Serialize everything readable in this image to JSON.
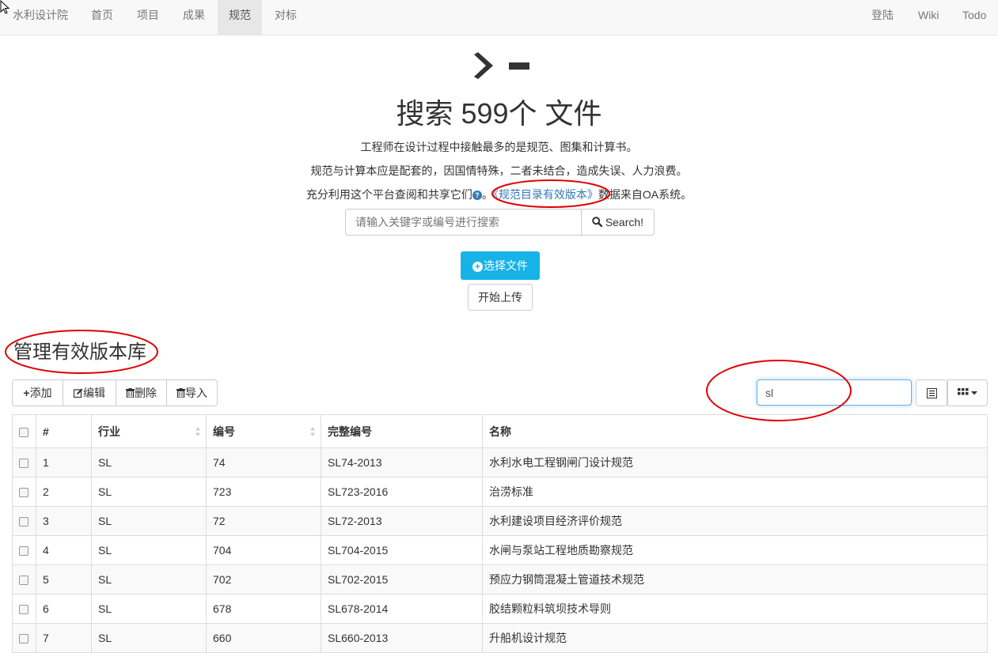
{
  "navbar": {
    "brand": "水利设计院",
    "items": [
      {
        "label": "首页",
        "active": false
      },
      {
        "label": "项目",
        "active": false
      },
      {
        "label": "成果",
        "active": false
      },
      {
        "label": "规范",
        "active": true
      },
      {
        "label": "对标",
        "active": false
      }
    ],
    "right_items": [
      "登陆",
      "Wiki",
      "Todo"
    ]
  },
  "hero": {
    "title": "搜索 599个 文件",
    "line1": "工程师在设计过程中接触最多的是规范、图集和计算书。",
    "line2": "规范与计算本应是配套的，因国情特殊，二者未结合，造成失误、人力浪费。",
    "line3_prefix": "充分利用这个平台查阅和共享它们",
    "line3_sep": "。",
    "line3_link": "《规范目录有效版本》",
    "line3_suffix": "数据来自OA系统。",
    "help_icon": "question-circle-icon"
  },
  "search": {
    "placeholder": "请输入关键字或编号进行搜索",
    "button_label": "Search!",
    "button_icon": "search-icon"
  },
  "upload": {
    "select_label": "选择文件",
    "select_icon": "plus-circle-icon",
    "start_label": "开始上传"
  },
  "section": {
    "title": "管理有效版本库"
  },
  "toolbar": {
    "buttons": [
      {
        "label": "添加",
        "icon": "plus-icon"
      },
      {
        "label": "编辑",
        "icon": "edit-icon"
      },
      {
        "label": "删除",
        "icon": "trash-icon"
      },
      {
        "label": "导入",
        "icon": "trash-icon"
      }
    ],
    "filter_value": "sl"
  },
  "table": {
    "columns": [
      "#",
      "行业",
      "编号",
      "完整编号",
      "名称"
    ],
    "rows": [
      {
        "num": "1",
        "industry": "SL",
        "code": "74",
        "full_code": "SL74-2013",
        "name": "水利水电工程钢闸门设计规范"
      },
      {
        "num": "2",
        "industry": "SL",
        "code": "723",
        "full_code": "SL723-2016",
        "name": "治涝标准"
      },
      {
        "num": "3",
        "industry": "SL",
        "code": "72",
        "full_code": "SL72-2013",
        "name": "水利建设项目经济评价规范"
      },
      {
        "num": "4",
        "industry": "SL",
        "code": "704",
        "full_code": "SL704-2015",
        "name": "水闸与泵站工程地质勘察规范"
      },
      {
        "num": "5",
        "industry": "SL",
        "code": "702",
        "full_code": "SL702-2015",
        "name": "预应力钢筒混凝土管道技术规范"
      },
      {
        "num": "6",
        "industry": "SL",
        "code": "678",
        "full_code": "SL678-2014",
        "name": "胶结颗粒料筑坝技术导则"
      },
      {
        "num": "7",
        "industry": "SL",
        "code": "660",
        "full_code": "SL660-2013",
        "name": "升船机设计规范"
      }
    ]
  },
  "colors": {
    "accent_button": "#17b3e7",
    "link": "#337ab7",
    "annotation_ellipse": "#e00000"
  }
}
